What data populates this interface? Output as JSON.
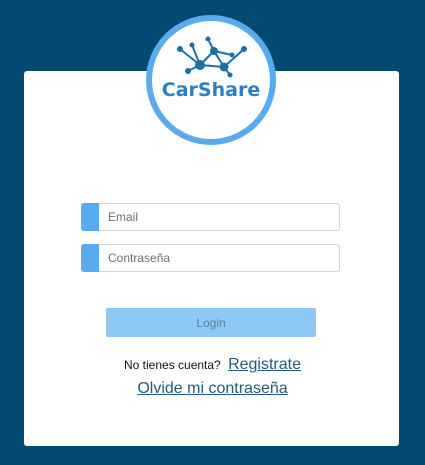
{
  "logo": {
    "brand_text": "CarShare",
    "ring_color": "#5aaaf0",
    "text_color": "#2a7fc6",
    "network_color": "#1b6fa5"
  },
  "form": {
    "email_placeholder": "Email",
    "password_placeholder": "Contraseña",
    "login_label": "Login"
  },
  "links": {
    "no_account_text": "No tienes cuenta?",
    "register_label": "Registrate",
    "forgot_label": "Olvide mi contraseña"
  },
  "colors": {
    "background": "#024a72",
    "card": "#ffffff",
    "addon": "#5aaaf0",
    "login_button": "#8ec9f6",
    "link": "#1f5c7e"
  }
}
